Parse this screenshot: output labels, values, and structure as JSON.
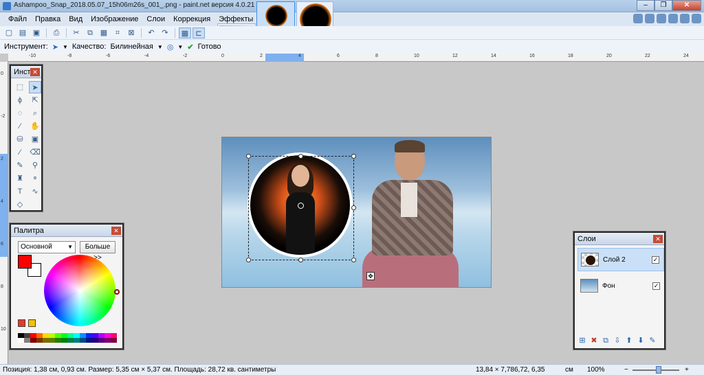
{
  "window": {
    "title": "Ashampoo_Snap_2018.05.07_15h06m26s_001_.png - paint.net версия 4.0.21"
  },
  "menu": [
    "Файл",
    "Правка",
    "Вид",
    "Изображение",
    "Слои",
    "Коррекция",
    "Эффекты"
  ],
  "options": {
    "tool_label": "Инструмент:",
    "quality_label": "Качество:",
    "quality_value": "Билинейная",
    "finish_label": "Готово"
  },
  "ruler": {
    "h_ticks": [
      "-10",
      "-8",
      "-6",
      "-4",
      "-2",
      "0",
      "2",
      "4",
      "6",
      "8",
      "10",
      "12",
      "14",
      "16",
      "18",
      "20",
      "22",
      "24"
    ],
    "v_ticks": [
      "0",
      "-2",
      "2",
      "4",
      "6",
      "8",
      "10"
    ]
  },
  "panels": {
    "tools_title": "Инст...",
    "palette_title": "Палитра",
    "palette_mode": "Основной",
    "palette_more": "Больше >>",
    "primary_color": "#ff0000",
    "secondary_color": "#ffffff",
    "swatches": [
      "#000000",
      "#404040",
      "#ff0000",
      "#ff6a00",
      "#ffd800",
      "#b6ff00",
      "#4cff00",
      "#00ff21",
      "#00ff90",
      "#00ffff",
      "#0094ff",
      "#0026ff",
      "#4800ff",
      "#b200ff",
      "#ff00dc",
      "#ff006e",
      "#ffffff",
      "#808080",
      "#7f0000",
      "#7f3300",
      "#7f6a00",
      "#5b7f00",
      "#267f00",
      "#007f0e",
      "#007f46",
      "#007f7f",
      "#004a7f",
      "#00137f",
      "#21007f",
      "#57007f",
      "#7f006e",
      "#7f0037"
    ],
    "layers_title": "Слои",
    "layers": [
      {
        "name": "Слой 2",
        "visible": true,
        "selected": true
      },
      {
        "name": "Фон",
        "visible": true,
        "selected": false
      }
    ]
  },
  "status": {
    "text": "Позиция: 1,38 см, 0,93 см. Размер: 5,35 см × 5,37 см. Площадь: 28,72 кв. сантиметры",
    "image_size": "13,84 × 7,78",
    "cursor": "6,72, 6,35",
    "unit": "см",
    "zoom": "100%"
  }
}
